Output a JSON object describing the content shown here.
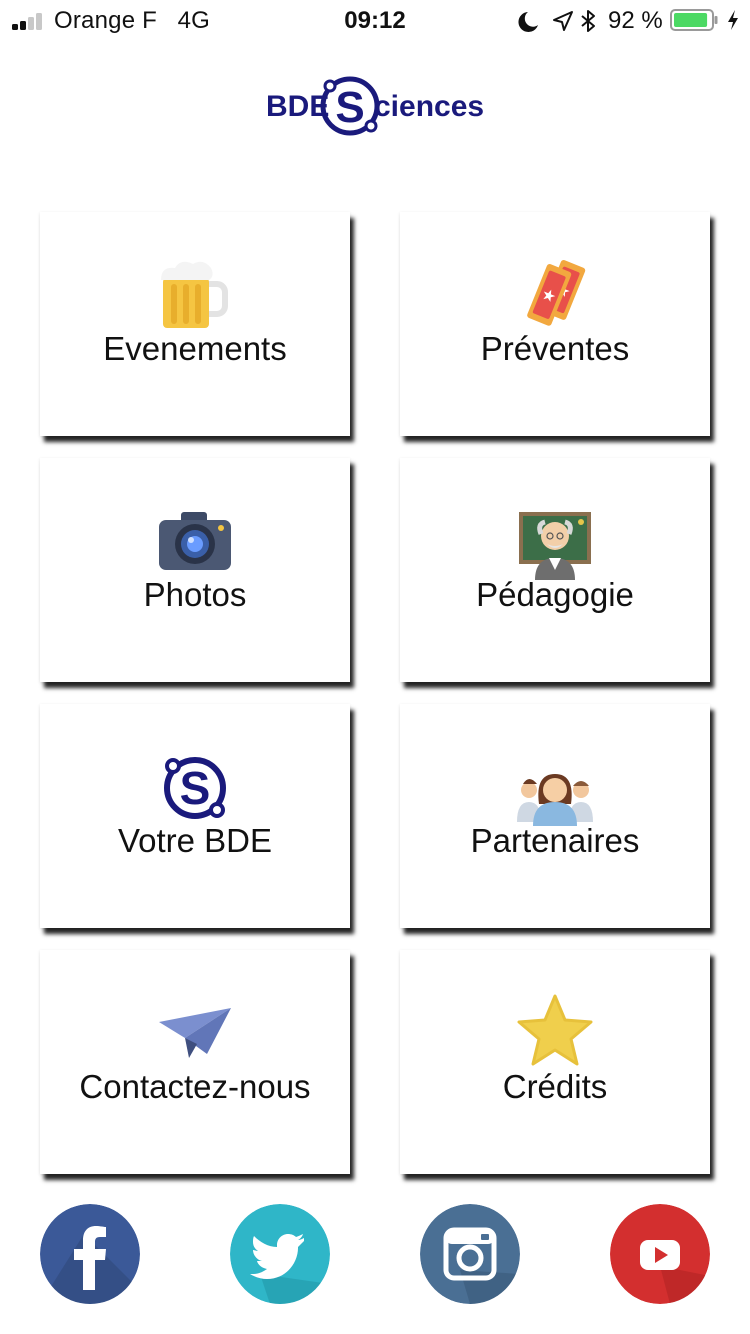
{
  "status_bar": {
    "carrier": "Orange F",
    "network": "4G",
    "time": "09:12",
    "battery_percent": "92 %",
    "battery_level": 0.92,
    "battery_color": "#4cd964",
    "icons": [
      "moon-icon",
      "location-arrow-icon",
      "bluetooth-icon",
      "charging-bolt-icon"
    ]
  },
  "logo": {
    "text_left": "BDE",
    "text_right": "ciences",
    "letter": "S",
    "color": "#1a1a7c"
  },
  "tiles": [
    {
      "label": "Evenements",
      "icon": "beer-mug-icon"
    },
    {
      "label": "Préventes",
      "icon": "tickets-icon"
    },
    {
      "label": "Photos",
      "icon": "camera-icon"
    },
    {
      "label": "Pédagogie",
      "icon": "professor-icon"
    },
    {
      "label": "Votre BDE",
      "icon": "bde-logo-icon"
    },
    {
      "label": "Partenaires",
      "icon": "people-icon"
    },
    {
      "label": "Contactez-nous",
      "icon": "paper-plane-icon"
    },
    {
      "label": "Crédits",
      "icon": "star-icon"
    }
  ],
  "social": [
    {
      "name": "facebook",
      "icon": "facebook-icon",
      "color": "#3b5998"
    },
    {
      "name": "twitter",
      "icon": "twitter-icon",
      "color": "#2fb6c8"
    },
    {
      "name": "instagram",
      "icon": "instagram-icon",
      "color": "#4a6f94"
    },
    {
      "name": "youtube",
      "icon": "youtube-icon",
      "color": "#d32f2f"
    }
  ]
}
